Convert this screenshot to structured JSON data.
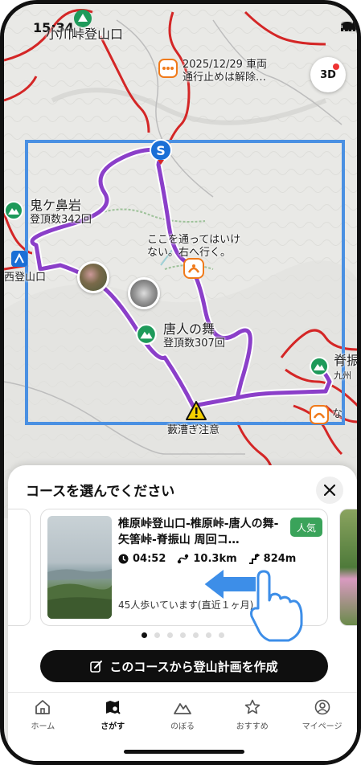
{
  "status_bar": {
    "time": "15:34"
  },
  "map": {
    "labels": {
      "trailhead_top": "小川峠登山口",
      "road_notice_line1": "2025/12/29 車両",
      "road_notice_line2": "通行止めは解除…",
      "peak_onigahana": "鬼ケ鼻岩",
      "peak_onigahana_count": "登頂数342回",
      "warning_note_line1": "ここを通ってはいけ",
      "warning_note_line2": "ない。右へ行く。",
      "trailhead_left": "西登山口",
      "peak_karato": "唐人の舞",
      "peak_karato_count": "登頂数307回",
      "peak_right": "脊振",
      "peak_right_sub": "九州",
      "hazard_label": "藪漕ぎ注意",
      "start_marker": "S",
      "right_clip": "な"
    },
    "button_3d": "3D"
  },
  "sheet": {
    "title": "コースを選んでください",
    "course": {
      "title": "椎原峠登山口-椎原峠-唐人の舞-矢筈峠-脊振山 周回コ…",
      "badge": "人気",
      "duration": "04:52",
      "distance": "10.3km",
      "elevation": "824m",
      "walkers": "45人歩いています(直近１ヶ月)"
    },
    "pagination": {
      "count": 7,
      "active": 0
    },
    "plan_button": "このコースから登山計画を作成"
  },
  "tabs": [
    {
      "label": "ホーム",
      "icon": "home-icon"
    },
    {
      "label": "さがす",
      "icon": "map-search-icon",
      "active": true
    },
    {
      "label": "のぼる",
      "icon": "mountain-icon"
    },
    {
      "label": "おすすめ",
      "icon": "star-icon"
    },
    {
      "label": "マイページ",
      "icon": "user-icon"
    }
  ],
  "colors": {
    "route": "#8b3fc9",
    "road": "#d42626",
    "selection": "#4a90e2",
    "peak_badge": "#1e9a5a",
    "popular_badge": "#3aa35a"
  }
}
